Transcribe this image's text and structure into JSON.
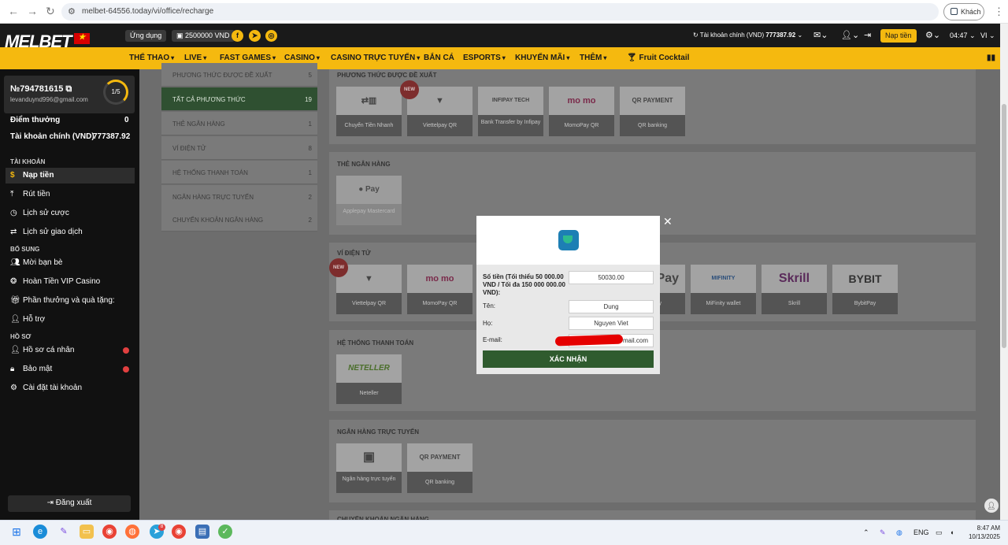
{
  "browser": {
    "url": "melbet-64556.today/vi/office/recharge",
    "guest_label": "Khách"
  },
  "header": {
    "logo_text": "MELBET",
    "app_label": "Ứng dụng",
    "bonus_label": "2500000 VND",
    "account_label": "Tài khoản chính (VND)",
    "account_balance": "777387.92",
    "mail_badge": "0",
    "deposit_button": "Nạp tiền",
    "time": "04:47",
    "language": "VI"
  },
  "menu": {
    "items": [
      "THỂ THAO",
      "LIVE",
      "FAST GAMES",
      "CASINO",
      "CASINO TRỰC TUYẾN",
      "BẮN CÁ",
      "ESPORTS",
      "KHUYẾN MÃI",
      "THÊM",
      "Fruit Cocktail"
    ]
  },
  "sidebar": {
    "user_id": "№794781615",
    "email": "levanduynd996@gmail.com",
    "level": "1/5",
    "points_label": "Điểm thưởng",
    "points_value": "0",
    "main_account_label": "Tài khoản chính (VND)",
    "main_account_value": "777387.92",
    "section_account": "TÀI KHOẢN",
    "deposit": "Nạp tiền",
    "withdraw": "Rút tiền",
    "bet_history": "Lịch sử cược",
    "transaction_history": "Lịch sử giao dịch",
    "section_extra": "BỔ SUNG",
    "invite": "Mời bạn bè",
    "vip_cashback": "Hoàn Tiền VIP Casino",
    "rewards": "Phần thưởng và quà tặng:",
    "support": "Hỗ trợ",
    "section_profile": "HỒ SƠ",
    "personal_profile": "Hồ sơ cá nhân",
    "security": "Bảo mật",
    "account_settings": "Cài đặt tài khoản",
    "logout": "Đăng xuất"
  },
  "methods": [
    {
      "label": "PHƯƠNG THỨC ĐƯỢC ĐỀ XUẤT",
      "count": "5"
    },
    {
      "label": "TẤT CẢ PHƯƠNG THỨC",
      "count": "19"
    },
    {
      "label": "THẺ NGÂN HÀNG",
      "count": "1"
    },
    {
      "label": "VÍ ĐIỆN TỬ",
      "count": "8"
    },
    {
      "label": "HỆ THỐNG THANH TOÁN",
      "count": "1"
    },
    {
      "label": "NGÂN HÀNG TRỰC TUYẾN",
      "count": "2"
    },
    {
      "label": "CHUYỂN KHOẢN NGÂN HÀNG",
      "count": "2"
    }
  ],
  "sections": {
    "recommended": {
      "title": "PHƯƠNG THỨC ĐƯỢC ĐỀ XUẤT",
      "cards": [
        "Chuyển Tiền Nhanh",
        "Viettelpay QR",
        "Bank Transfer by Infipay",
        "MomoPay QR",
        "QR banking"
      ],
      "logos": [
        "⇄▥",
        "",
        "INFIPAY TECH",
        "mo mo",
        "QR PAYMENT"
      ]
    },
    "bank_cards": {
      "title": "THẺ NGÂN HÀNG",
      "cards": [
        "Applepay Mastercard"
      ],
      "logos": [
        "● Pay"
      ]
    },
    "ewallets": {
      "title": "VÍ ĐIỆN TỬ",
      "cards": [
        "Viettelpay QR",
        "MomoPay QR",
        "ay",
        "MiFinity wallet",
        "Skrill",
        "BybitPay"
      ],
      "logos": [
        "",
        "mo mo",
        "Pay",
        "MIFINITY",
        "Skrill",
        "BYBIT"
      ]
    },
    "payment_systems": {
      "title": "HỆ THỐNG THANH TOÁN",
      "cards": [
        "Neteller"
      ],
      "logos": [
        "NETELLER"
      ]
    },
    "online_banking": {
      "title": "NGÂN HÀNG TRỰC TUYẾN",
      "cards": [
        "Ngân hàng trực tuyến",
        "QR banking"
      ],
      "logos": [
        "▣",
        "QR PAYMENT"
      ]
    },
    "bank_transfer": {
      "title": "CHUYỂN KHOẢN NGÂN HÀNG"
    }
  },
  "new_badge": "NEW",
  "modal": {
    "amount_label": "Số tiền (Tối thiểu 50 000.00 VND / Tối đa 150 000 000.00 VND):",
    "amount_value": "50030.00",
    "first_name_label": "Tên:",
    "first_name_value": "Dung",
    "last_name_label": "Họ:",
    "last_name_value": "Nguyen Viet",
    "email_label": "E-mail:",
    "email_value": "mail.com",
    "submit": "XÁC NHẬN"
  },
  "taskbar": {
    "language": "ENG",
    "time": "8:47 AM",
    "date": "10/13/2025",
    "telegram_badge": "8"
  },
  "colors": {
    "brand_yellow": "#f5b90f",
    "header_dark": "#1a1a1a",
    "submit_green": "#2f5b2e"
  }
}
